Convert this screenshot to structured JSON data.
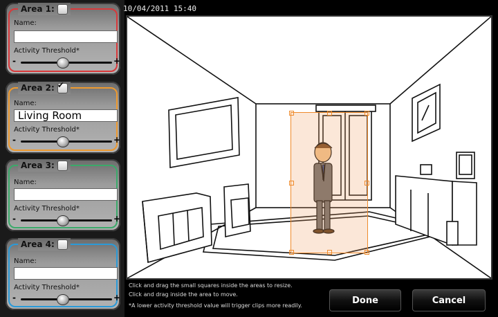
{
  "timestamp": "10/04/2011 15:40",
  "areas": [
    {
      "title": "Area 1:",
      "checked": false,
      "color": "#d9383a",
      "name_label": "Name:",
      "name_value": "",
      "threshold_label": "Activity Threshold*",
      "threshold": 0.45
    },
    {
      "title": "Area 2:",
      "checked": true,
      "color": "#ef9a2e",
      "name_label": "Name:",
      "name_value": "Living Room",
      "threshold_label": "Activity Threshold*",
      "threshold": 0.45
    },
    {
      "title": "Area 3:",
      "checked": false,
      "color": "#3aaa6a",
      "name_label": "Name:",
      "name_value": "",
      "threshold_label": "Activity Threshold*",
      "threshold": 0.45
    },
    {
      "title": "Area 4:",
      "checked": false,
      "color": "#2a9ad8",
      "name_label": "Name:",
      "name_value": "",
      "threshold_label": "Activity Threshold*",
      "threshold": 0.45
    }
  ],
  "slider": {
    "minus": "-",
    "plus": "+"
  },
  "hints": {
    "resize": "Click and drag the small squares inside the areas to resize.",
    "move": "Click and drag inside the area to move.",
    "threshold": "*A lower activity threshold value will trigger clips more readily."
  },
  "buttons": {
    "done": "Done",
    "cancel": "Cancel"
  },
  "check_glyph": "✔"
}
